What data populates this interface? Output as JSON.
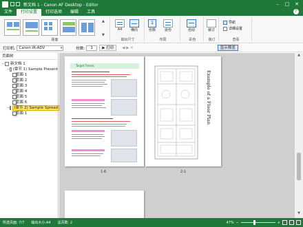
{
  "titlebar": {
    "title": "新文档 1 - Canon AF Desktop - Editor",
    "minimize": "–",
    "maximize": "□",
    "close": "✕"
  },
  "menu": {
    "tabs": [
      "文件",
      "打印设置",
      "打印选项",
      "编辑",
      "工具"
    ],
    "active": 1,
    "help": "?"
  },
  "ribbon": {
    "groups": {
      "layout": "版面",
      "output_size": "输出尺寸",
      "layout2": "布局",
      "color": "彩色",
      "finish": "装订",
      "view": "查看"
    },
    "buttons": {
      "paper_size": "A4",
      "orientation": "横向",
      "copies": "1",
      "copies_label": "份数",
      "collate": "逐份",
      "color": "自动",
      "finish": "装订",
      "nav": "导航",
      "detail": "详细设置"
    }
  },
  "printbar": {
    "printer_label": "打印机:",
    "printer_value": "Canon iR-ADV",
    "copies_label": "份数:",
    "copies_value": "1",
    "print_button": "打印",
    "zoom_toggle": "显示预览"
  },
  "leftpane": {
    "header": "页面树",
    "tree": [
      {
        "level": 0,
        "label": "新文档 1",
        "expander": "−",
        "kind": "doc"
      },
      {
        "level": 1,
        "label": "(章节 1) Sample Present",
        "expander": "−",
        "kind": "doc"
      },
      {
        "level": 2,
        "label": "页面 1",
        "kind": "page"
      },
      {
        "level": 2,
        "label": "页面 2",
        "kind": "page"
      },
      {
        "level": 2,
        "label": "页面 3",
        "kind": "page"
      },
      {
        "level": 2,
        "label": "页面 4",
        "kind": "page"
      },
      {
        "level": 2,
        "label": "页面 5",
        "kind": "page"
      },
      {
        "level": 2,
        "label": "页面 6",
        "kind": "page"
      },
      {
        "level": 1,
        "label": "(章节 2) Sample Spread",
        "expander": "−",
        "kind": "doc",
        "selected": true
      },
      {
        "level": 2,
        "label": "页面 1",
        "kind": "page"
      }
    ]
  },
  "preview": {
    "page1_caption": "1-6",
    "page2_caption": "2-1",
    "page1_heading": "Target Trends",
    "page2_title": "Example of a Floor Plan"
  },
  "statusbar": {
    "page_info": "所选页面: 7/7",
    "output_size": "输出大小:A4",
    "total": "总页数: 2",
    "zoom": "47%",
    "zoom_minus": "−",
    "zoom_plus": "+"
  },
  "colors": {
    "brand": "#1f7a3a",
    "selection": "#ffe36a",
    "accent": "#3a76c4"
  }
}
